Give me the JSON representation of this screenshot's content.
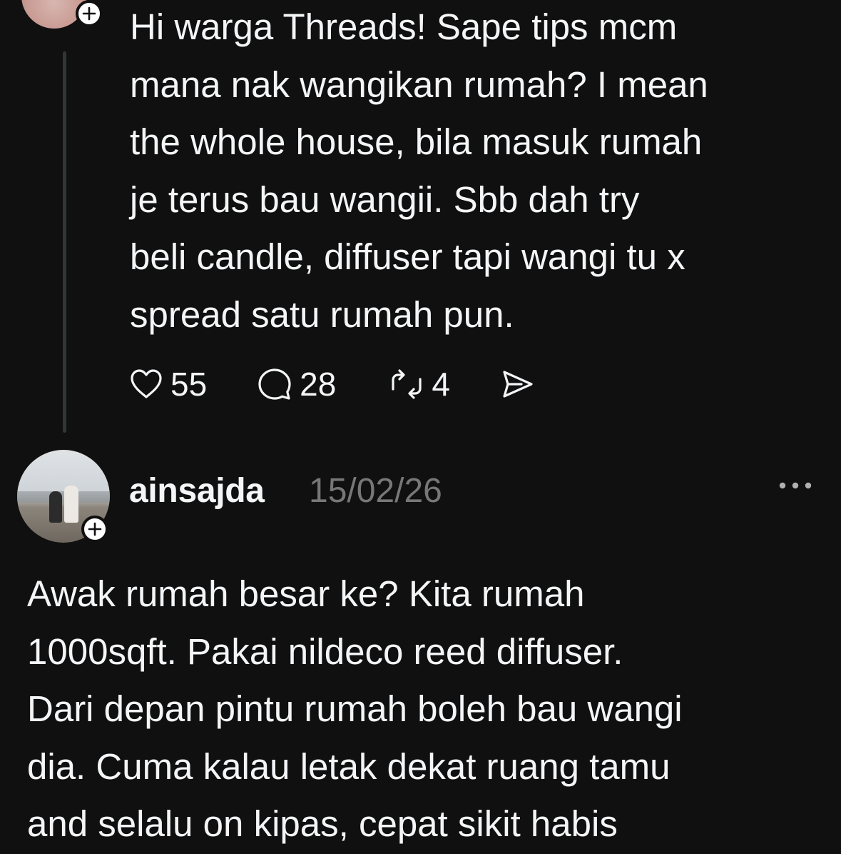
{
  "post1": {
    "text": "Hi warga Threads! Sape tips mcm\nmana nak wangikan rumah? I mean\nthe whole house, bila masuk rumah\nje terus bau wangii. Sbb dah try\nbeli candle, diffuser tapi wangi tu x\nspread satu rumah pun.",
    "likes": "55",
    "replies": "28",
    "reposts": "4"
  },
  "post2": {
    "username": "ainsajda",
    "date": "15/02/26",
    "text": "Awak rumah besar ke? Kita rumah\n1000sqft. Pakai nildeco reed diffuser.\nDari depan pintu rumah boleh bau wangi\ndia. Cuma kalau letak dekat ruang tamu\nand selalu on kipas, cepat sikit habis"
  },
  "icons": {
    "like": "heart-icon",
    "reply": "comment-icon",
    "repost": "repost-icon",
    "share": "send-icon",
    "follow": "plus-icon",
    "more": "more-icon"
  },
  "colors": {
    "background": "#101010",
    "text": "#f3f5f7",
    "muted": "#777777",
    "thread_line": "#333638"
  }
}
